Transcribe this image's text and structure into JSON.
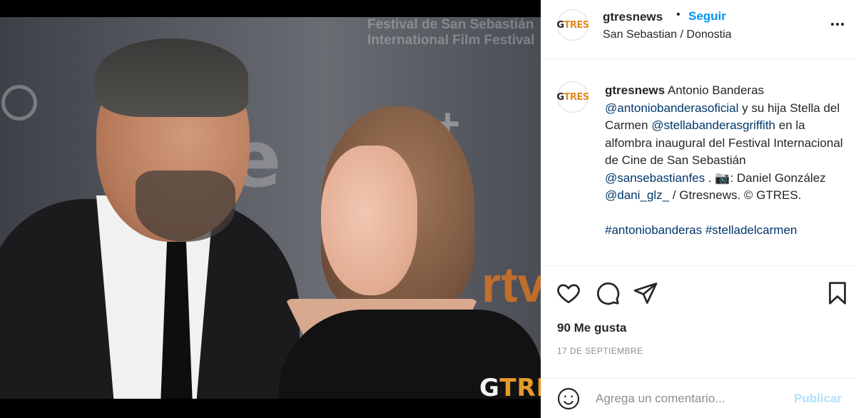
{
  "post": {
    "photo_watermark": {
      "g": "G",
      "rest": "TRES"
    },
    "backdrop": {
      "line1": "Festival de San Sebastián",
      "line2": "International Film Festival"
    }
  },
  "header": {
    "avatar_letters": {
      "g": "G",
      "rest": "TRES"
    },
    "username": "gtresnews",
    "separator": "•",
    "follow_label": "Seguir",
    "location": "San Sebastian / Donostia"
  },
  "caption": {
    "username": "gtresnews",
    "text_1": " Antonio Banderas ",
    "mention_1": "@antoniobanderasoficial",
    "text_2": " y su hija Stella del Carmen ",
    "mention_2": "@stellabanderasgriffith",
    "text_3": " en la alfombra inaugural del Festival Internacional de Cine de San Sebastián ",
    "mention_3": "@sansebastianfes",
    "text_4": " . 📷: Daniel González ",
    "mention_4": "@dani_glz_",
    "text_5": " / Gtresnews. © GTRES.",
    "hashtags": "#antoniobanderas #stelladelcarmen"
  },
  "actions": {
    "like_icon": "heart-icon",
    "comment_icon": "comment-bubble-icon",
    "share_icon": "paper-plane-icon",
    "save_icon": "bookmark-icon"
  },
  "likes": "90 Me gusta",
  "date": "17 DE SEPTIEMBRE",
  "comment": {
    "placeholder": "Agrega un comentario...",
    "publish_label": "Publicar"
  },
  "colors": {
    "link_blue": "#0095f6",
    "mention": "#00376b",
    "publish_disabled": "#b2dffc",
    "brand_orange": "#e48b22"
  }
}
